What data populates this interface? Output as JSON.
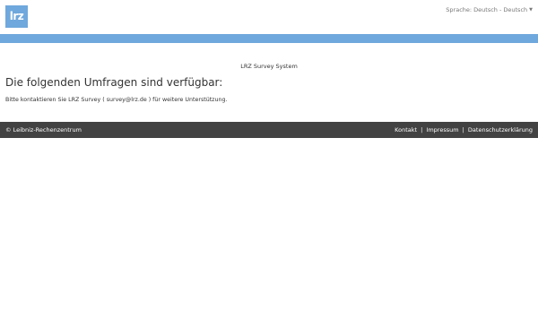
{
  "header": {
    "logo_text": "lrz",
    "language_label": "Sprache: Deutsch - Deutsch",
    "caret_icon": "caret-down-icon"
  },
  "main": {
    "system_title": "LRZ Survey System",
    "heading": "Die folgenden Umfragen sind verfügbar:",
    "contact_text": "Bitte kontaktieren Sie LRZ Survey ( survey@lrz.de ) für weitere Unterstützung."
  },
  "footer": {
    "copyright": "© Leibniz-Rechenzentrum",
    "links": [
      "Kontakt",
      "Impressum",
      "Datenschutzerklärung"
    ],
    "separator": "|"
  },
  "colors": {
    "accent_blue": "#6fa8dc",
    "footer_bg": "#424242"
  }
}
